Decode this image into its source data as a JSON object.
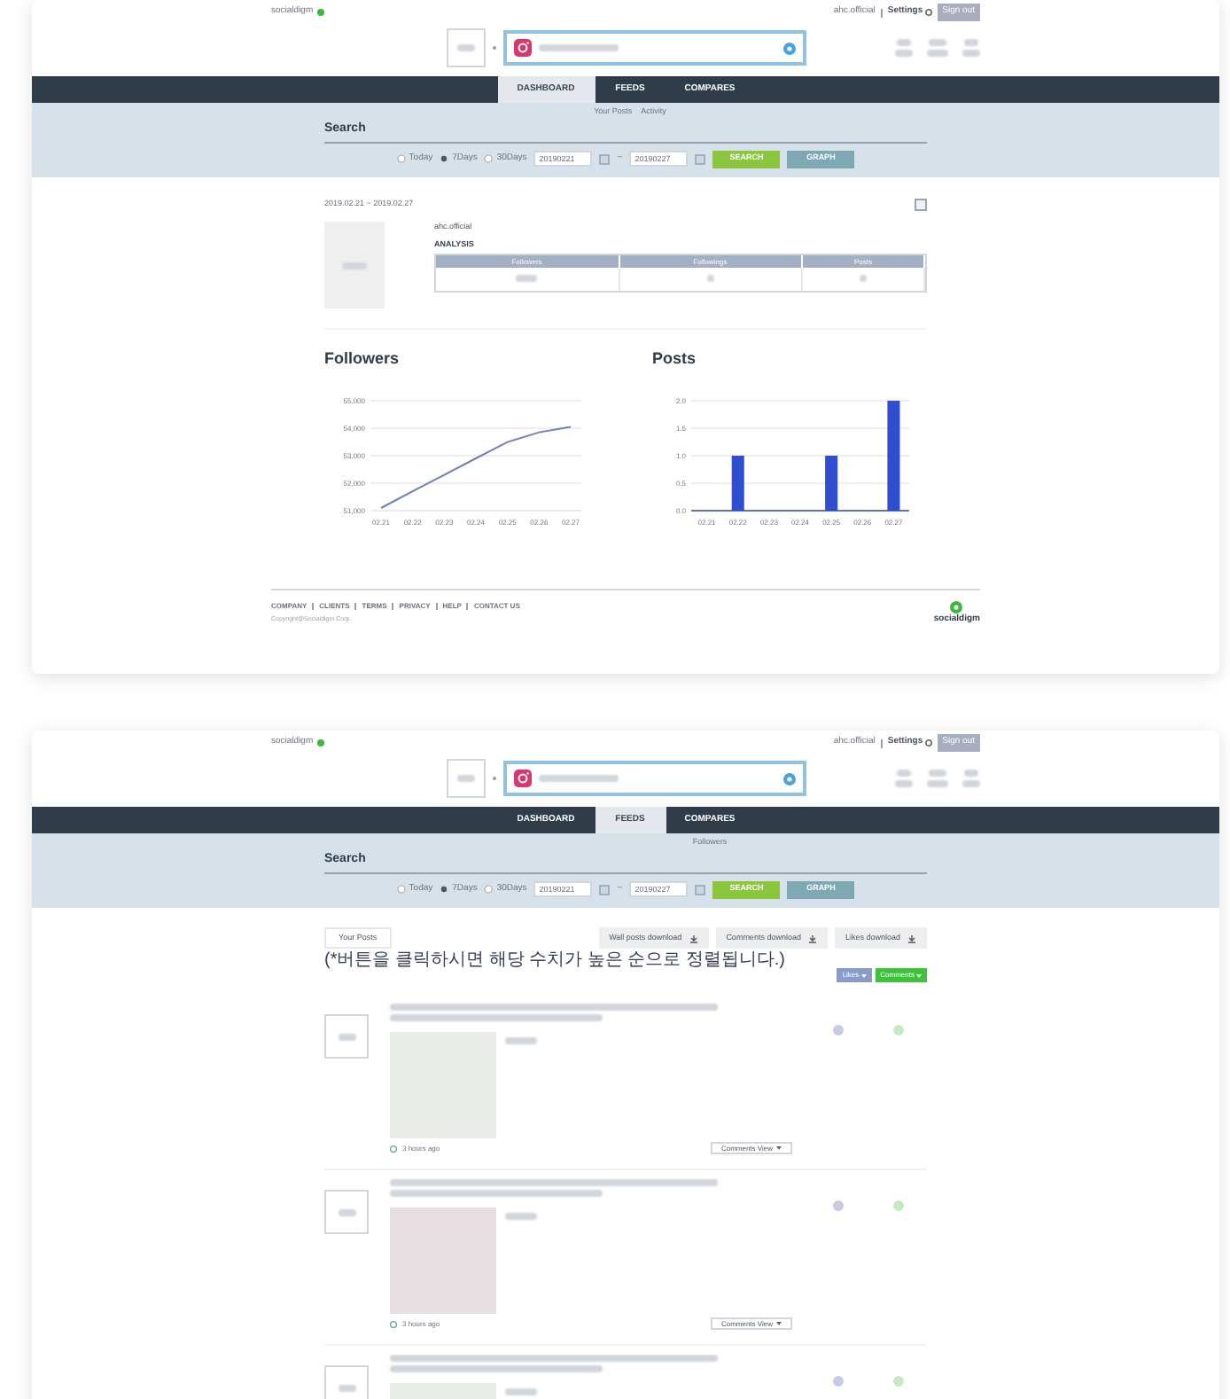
{
  "screens": [
    {
      "kind": "dashboard",
      "header": {
        "logo": "socialdigm",
        "account": "ahc.official",
        "settings": "Settings",
        "sign_out": "Sign out"
      },
      "nav": [
        {
          "label": "DASHBOARD",
          "selected": true
        },
        {
          "label": "FEEDS",
          "selected": false,
          "submenu": [
            "Your Posts",
            "Activity"
          ]
        },
        {
          "label": "COMPARES",
          "selected": false
        }
      ],
      "search": {
        "title": "Search",
        "periods": [
          {
            "label": "Today",
            "selected": false
          },
          {
            "label": "7Days",
            "selected": true
          },
          {
            "label": "30Days",
            "selected": false
          }
        ],
        "from": "20190221",
        "separator": "~",
        "to": "20190227",
        "buttons": [
          "SEARCH",
          "GRAPH"
        ]
      },
      "range": "2019.02.21 ~ 2019.02.27",
      "profile": {
        "account": "ahc.official",
        "heading": "ANALYSIS",
        "columns": [
          "Followers",
          "Followings",
          "Posts"
        ]
      },
      "charts": [
        {
          "title": "Followers",
          "chart_data": {
            "type": "line",
            "categories": [
              "02.21",
              "02.22",
              "02.23",
              "02.24",
              "02.25",
              "02.26",
              "02.27"
            ],
            "grid": true,
            "series": [
              {
                "color": "#6f7fb8",
                "values": [
                  51100,
                  51700,
                  52300,
                  52900,
                  53500,
                  53850,
                  54050
                ]
              }
            ],
            "ylim": [
              51000,
              55000
            ],
            "yticks": [
              {
                "value": 51000,
                "label": "51,000"
              },
              {
                "value": 52000,
                "label": "52,000"
              },
              {
                "value": 53000,
                "label": "53,000"
              },
              {
                "value": 54000,
                "label": "54,000"
              },
              {
                "value": 55000,
                "label": "55,000"
              }
            ]
          }
        },
        {
          "title": "Posts",
          "chart_data": {
            "type": "bar",
            "categories": [
              "02.21",
              "02.22",
              "02.23",
              "02.24",
              "02.25",
              "02.26",
              "02.27"
            ],
            "grid": true,
            "series": [
              {
                "color": "#2f4fd0",
                "values": [
                  0,
                  1,
                  0,
                  0,
                  1,
                  0,
                  2
                ]
              }
            ],
            "ylim": [
              0,
              2
            ],
            "yticks": [
              {
                "value": 0,
                "label": "0.0"
              },
              {
                "value": 0.5,
                "label": "0.5"
              },
              {
                "value": 1,
                "label": "1.0"
              },
              {
                "value": 1.5,
                "label": "1.5"
              },
              {
                "value": 2,
                "label": "2.0"
              }
            ]
          }
        }
      ],
      "footer": {
        "links": [
          "COMPANY",
          "CLIENTS",
          "TERMS",
          "PRIVACY",
          "HELP",
          "CONTACT US"
        ],
        "copyright": "Copyright@Socialdigm Corp.",
        "logo": "socialdigm"
      }
    },
    {
      "kind": "feeds",
      "header": {
        "logo": "socialdigm",
        "account": "ahc.official",
        "settings": "Settings",
        "sign_out": "Sign out"
      },
      "nav": [
        {
          "label": "DASHBOARD",
          "selected": false
        },
        {
          "label": "FEEDS",
          "selected": true
        },
        {
          "label": "COMPARES",
          "selected": false,
          "submenu": [
            "Followers"
          ]
        }
      ],
      "search": {
        "title": "Search",
        "periods": [
          {
            "label": "Today",
            "selected": false
          },
          {
            "label": "7Days",
            "selected": true
          },
          {
            "label": "30Days",
            "selected": false
          }
        ],
        "from": "20190221",
        "separator": "~",
        "to": "20190227",
        "buttons": [
          "SEARCH",
          "GRAPH"
        ]
      },
      "feed": {
        "tab": "Your Posts",
        "downloads": [
          "Wall posts download",
          "Comments download",
          "Likes download"
        ],
        "note": "(*버튼을 클릭하시면 해당 수치가 높은 순으로 정렬됩니다.)",
        "sort": [
          {
            "label": "Likes",
            "color": "#8a9cc8"
          },
          {
            "label": "Comments",
            "color": "#3cc23c"
          }
        ],
        "posts": [
          {
            "time": "3 hours ago",
            "button": "Comments View"
          },
          {
            "time": "3 hours ago",
            "button": "Comments View"
          },
          {
            "cut_off": true
          }
        ]
      }
    }
  ]
}
